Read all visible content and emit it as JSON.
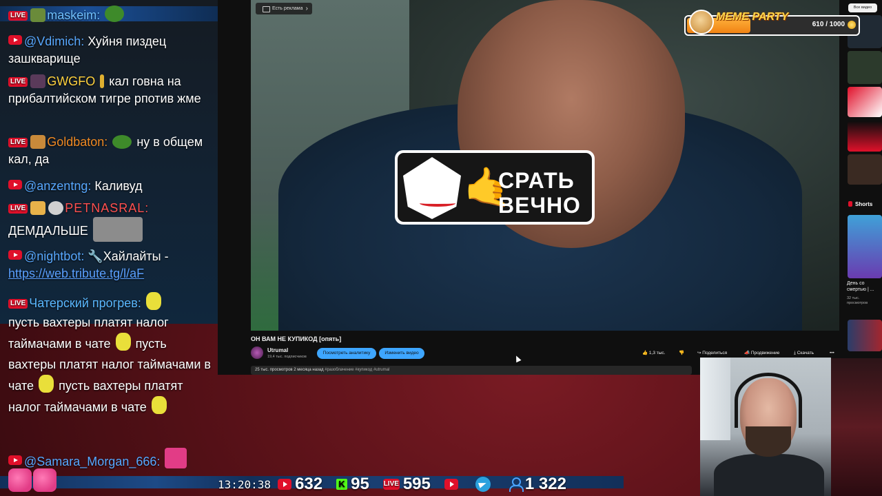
{
  "chat": {
    "messages": [
      {
        "nick": "maskeim:",
        "text": ""
      },
      {
        "nick": "@Vdimich:",
        "text": "Хуйня пиздец зашкварище"
      },
      {
        "nick": "GWGFO",
        "text": "кал говна на прибалтийском тигре рпотив жме"
      },
      {
        "nick": "Goldbaton:",
        "text": "ну в общем кал, да"
      },
      {
        "nick": "@anzentng:",
        "text": "Каливуд"
      },
      {
        "nick": "PETNASRAL:",
        "text": "ДЕМДАЛЬШЕ"
      },
      {
        "nick": "@nightbot:",
        "text": "Хайлайты -",
        "link": "https://web.tribute.tg/l/aF"
      },
      {
        "nick": "Чатерский прогрев:",
        "text": "пусть вахтеры платят налог таймачами в чате",
        "text2": "пусть вахтеры платят налог таймачами в чате",
        "text3": "пусть вахтеры платят налог таймачами в чате"
      },
      {
        "nick": "@Samara_Morgan_666:",
        "text": ""
      }
    ],
    "badges": {
      "live": "LIVE"
    }
  },
  "video": {
    "ad_chip": "Есть реклама",
    "sticker_text_line1": "СРАТЬ",
    "sticker_text_line2": "ВЕЧНО",
    "title": "ОН ВАМ НЕ КУПИКОД [опять]",
    "channel_name": "Utrumal",
    "channel_subs": "19,4 тыс. подписчиков",
    "btn_analytics": "Посмотреть аналитику",
    "btn_edit": "Изменить видео",
    "likes": "1,3 тыс.",
    "share": "Поделиться",
    "promote": "Продвижение",
    "download": "Скачать",
    "more": "•••",
    "views": "25 тыс. просмотров",
    "ago": "2 месяца назад",
    "tags": "#разоблачение #купикод #utrumal"
  },
  "sidebar": {
    "chip_all": "Все видео",
    "shorts_label": "Shorts",
    "short_title": "День со смертью | ...",
    "short_meta": "32 тыс. просмотров"
  },
  "meme_party": {
    "title": "MEME PARTY",
    "current": 610,
    "max": 1000,
    "count_text": "610 / 1000",
    "accent": "#f08314"
  },
  "stats": {
    "clock": "13:20:38",
    "youtube": "632",
    "kick": "95",
    "live": "595",
    "viewers": "1 322",
    "kick_letter": "K",
    "live_label": "LIVE"
  }
}
